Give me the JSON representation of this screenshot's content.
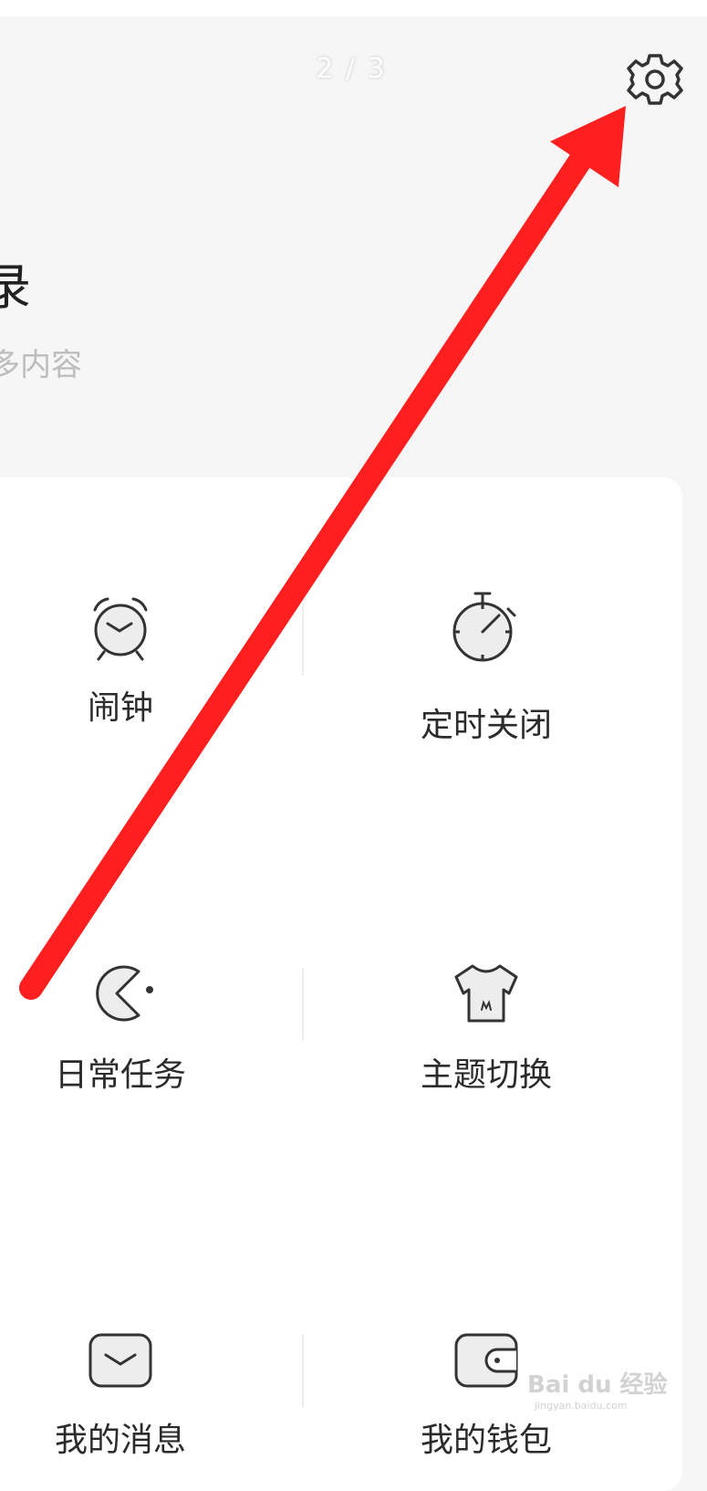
{
  "header": {
    "page_indicator": "2 / 3",
    "settings_icon": "gear-icon"
  },
  "intro": {
    "title": "录",
    "subtitle": "多内容"
  },
  "grid": {
    "items": [
      {
        "label": "闹钟",
        "icon": "alarm-clock-icon"
      },
      {
        "label": "定时关闭",
        "icon": "stopwatch-icon"
      },
      {
        "label": "日常任务",
        "icon": "pacman-icon"
      },
      {
        "label": "主题切换",
        "icon": "tshirt-icon"
      },
      {
        "label": "我的消息",
        "icon": "envelope-icon"
      },
      {
        "label": "我的钱包",
        "icon": "wallet-icon"
      }
    ]
  },
  "annotation": {
    "color": "#ff1f1f",
    "icon": "red-arrow"
  },
  "watermark": {
    "brand": "Bai du 经验",
    "domain": "jingyan.baidu.com"
  }
}
